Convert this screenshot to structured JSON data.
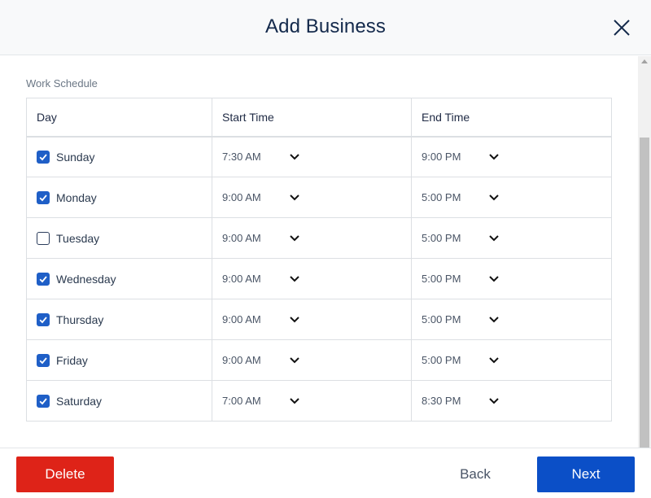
{
  "header": {
    "title": "Add Business",
    "close_icon": "close-icon"
  },
  "schedule": {
    "section_label": "Work Schedule",
    "columns": [
      "Day",
      "Start Time",
      "End Time"
    ],
    "rows": [
      {
        "day": "Sunday",
        "checked": true,
        "start": "7:30 AM",
        "end": "9:00 PM"
      },
      {
        "day": "Monday",
        "checked": true,
        "start": "9:00 AM",
        "end": "5:00 PM"
      },
      {
        "day": "Tuesday",
        "checked": false,
        "start": "9:00 AM",
        "end": "5:00 PM"
      },
      {
        "day": "Wednesday",
        "checked": true,
        "start": "9:00 AM",
        "end": "5:00 PM"
      },
      {
        "day": "Thursday",
        "checked": true,
        "start": "9:00 AM",
        "end": "5:00 PM"
      },
      {
        "day": "Friday",
        "checked": true,
        "start": "9:00 AM",
        "end": "5:00 PM"
      },
      {
        "day": "Saturday",
        "checked": true,
        "start": "7:00 AM",
        "end": "8:30 PM"
      }
    ]
  },
  "footer": {
    "delete_label": "Delete",
    "back_label": "Back",
    "next_label": "Next"
  },
  "colors": {
    "primary": "#0b4fc7",
    "danger": "#de2318",
    "checkbox": "#1f5fc7",
    "title": "#13294b"
  }
}
